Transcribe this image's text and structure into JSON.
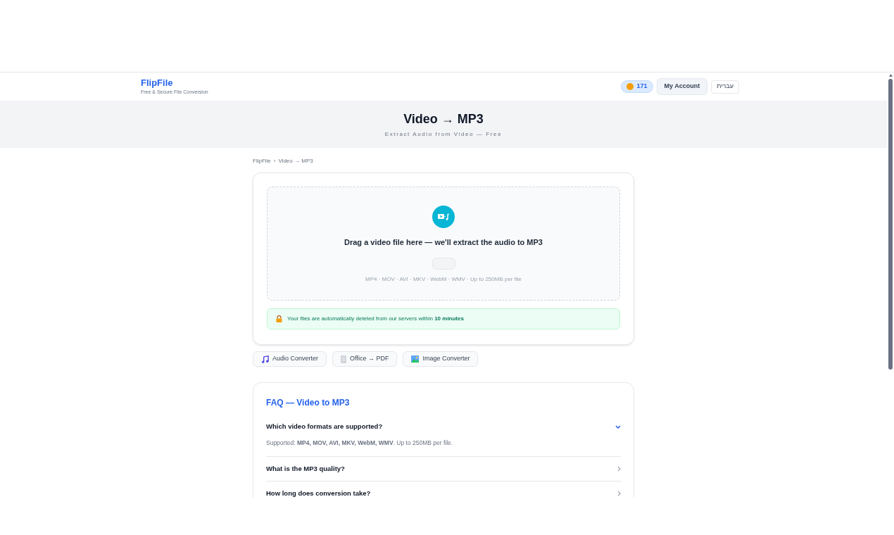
{
  "header": {
    "logo": "FlipFile",
    "tagline": "Free & Secure File Conversion",
    "credits": "171",
    "account_button": "My Account",
    "language_button": "עברית"
  },
  "hero": {
    "title": "Video → MP3",
    "subtitle": "Extract Audio from Video — Free"
  },
  "breadcrumb": [
    {
      "label": "FlipFile"
    },
    {
      "label": "Video → MP3"
    }
  ],
  "breadcrumb_separator": "›",
  "dropzone": {
    "prompt": "Drag a video file here — we'll extract the audio to MP3",
    "formats": "MP4 · MOV · AVI · MKV · WebM · WMV · Up to 250MB per file"
  },
  "notice": "Your files are automatically deleted from our servers within **10 minutes**",
  "tools": [
    {
      "label": "Audio Converter",
      "kind": "music"
    },
    {
      "label": "Office → PDF",
      "kind": "document"
    },
    {
      "label": "Image Converter",
      "kind": "image"
    }
  ],
  "faq": {
    "title": "FAQ — Video to MP3",
    "items": [
      {
        "question": "Which video formats are supported?",
        "expanded": true,
        "answer": "Supported: **MP4, MOV, AVI, MKV, WebM, WMV**. Up to 250MB per file."
      },
      {
        "question": "What is the MP3 quality?",
        "expanded": false
      },
      {
        "question": "How long does conversion take?",
        "expanded": false
      }
    ]
  }
}
